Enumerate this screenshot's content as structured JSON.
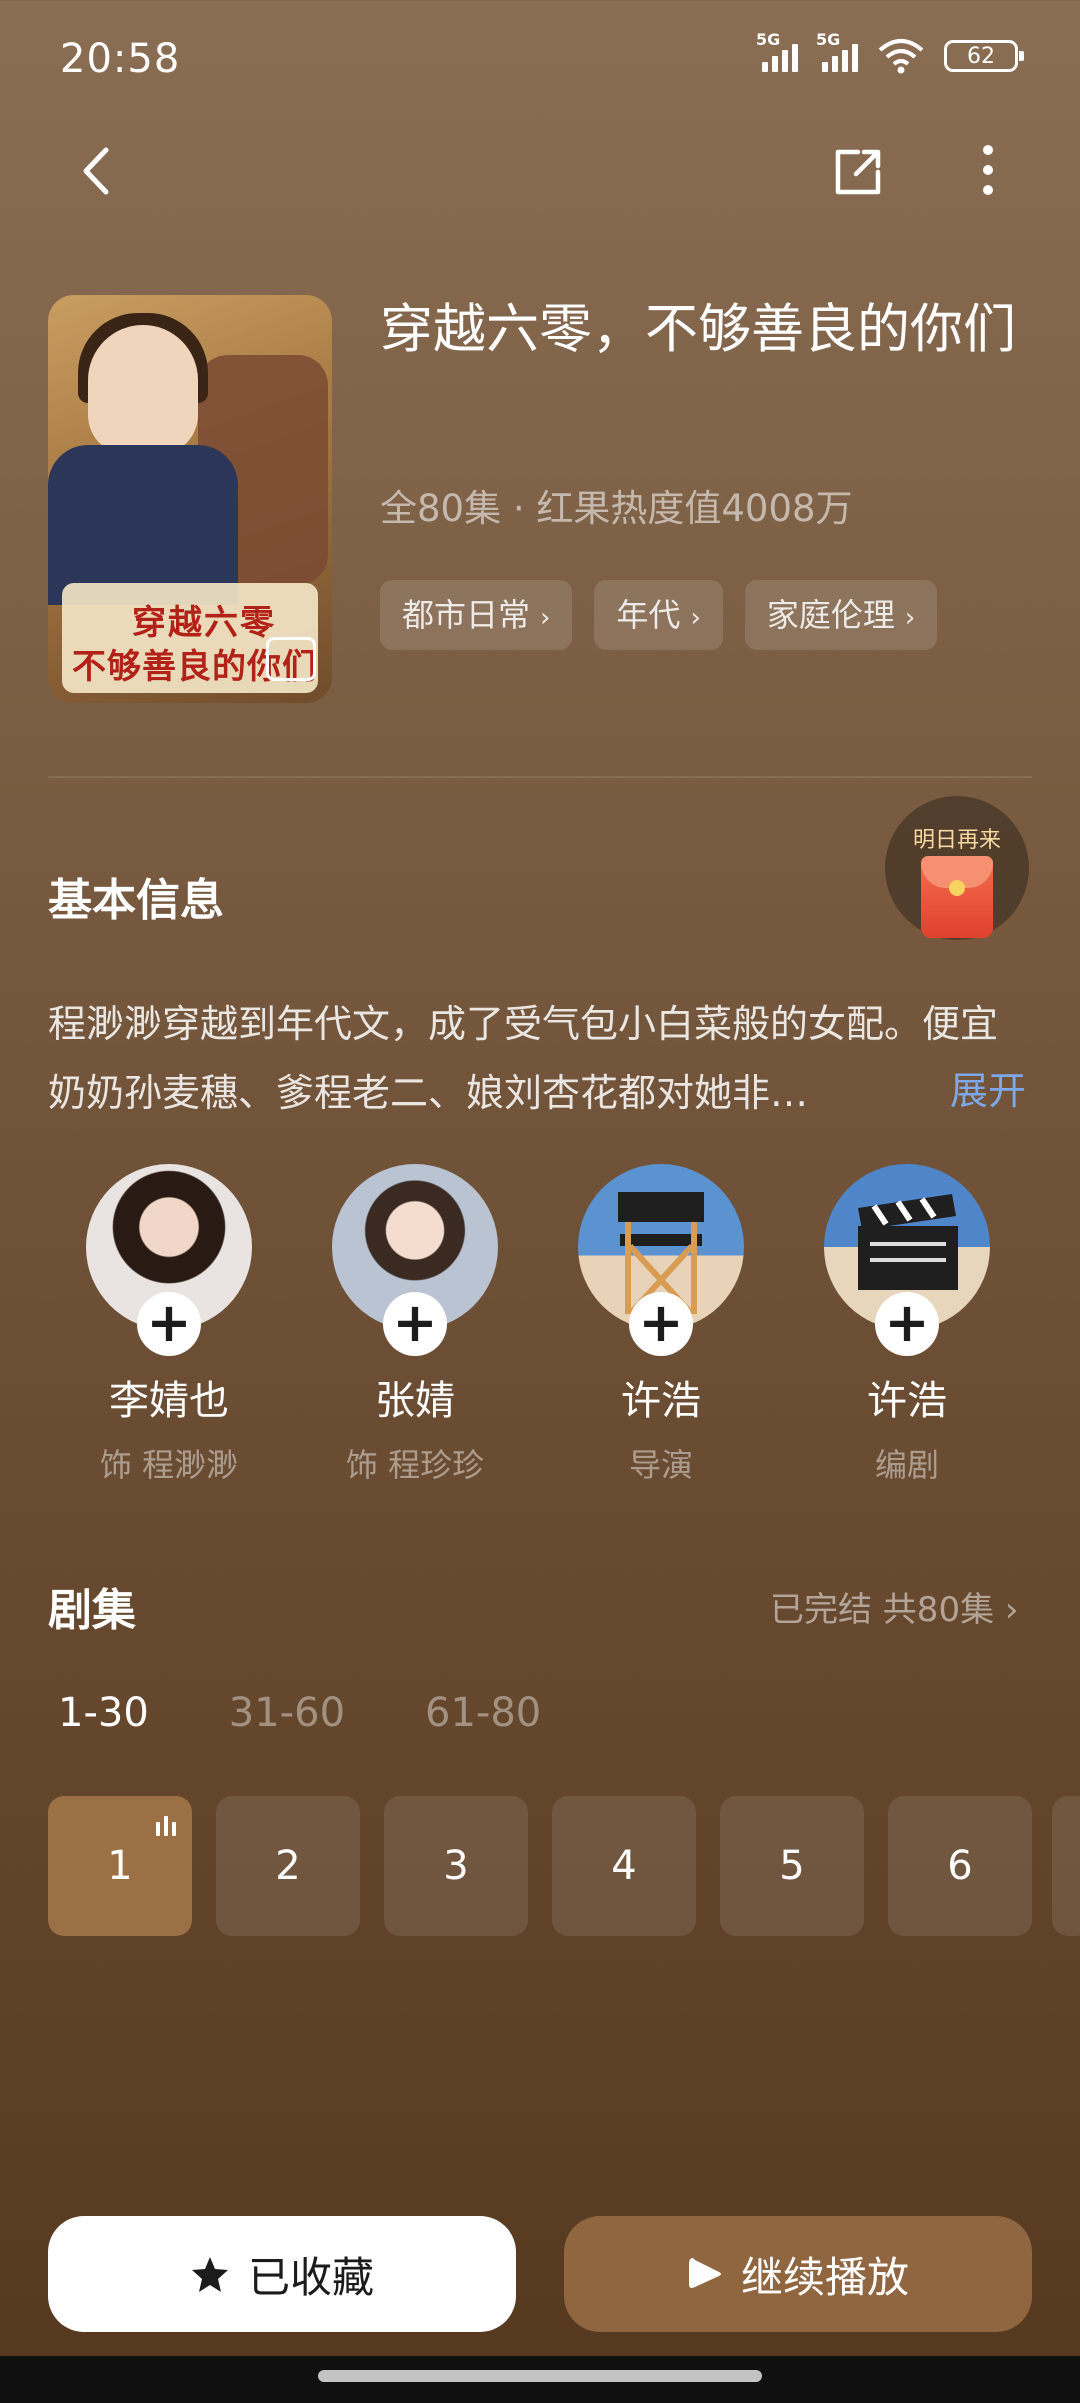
{
  "status": {
    "time": "20:58",
    "sim1": "5G",
    "sim2": "5G",
    "battery": "62"
  },
  "show": {
    "title": "穿越六零，不够善良的你们",
    "meta": "全80集 · 红果热度值4008万",
    "tags": [
      "都市日常",
      "年代",
      "家庭伦理"
    ],
    "poster_line1": "穿越六零",
    "poster_line2": "不够善良的你们"
  },
  "basic": {
    "title": "基本信息",
    "reward_label": "明日再来",
    "description": "程渺渺穿越到年代文，成了受气包小白菜般的女配。便宜奶奶孙麦穗、爹程老二、娘刘杏花都对她非…",
    "expand": "展开"
  },
  "cast": [
    {
      "name": "李婧也",
      "role": "饰 程渺渺"
    },
    {
      "name": "张婧",
      "role": "饰 程珍珍"
    },
    {
      "name": "许浩",
      "role": "导演"
    },
    {
      "name": "许浩",
      "role": "编剧"
    }
  ],
  "episodes": {
    "title": "剧集",
    "status": "已完结 共80集",
    "ranges": [
      "1-30",
      "31-60",
      "61-80"
    ],
    "items": [
      "1",
      "2",
      "3",
      "4",
      "5",
      "6"
    ]
  },
  "actions": {
    "favorite": "已收藏",
    "play": "继续播放"
  },
  "colors": {
    "accent": "#9b7044",
    "link": "#7ea8e8",
    "play_button": "#8f6640"
  }
}
